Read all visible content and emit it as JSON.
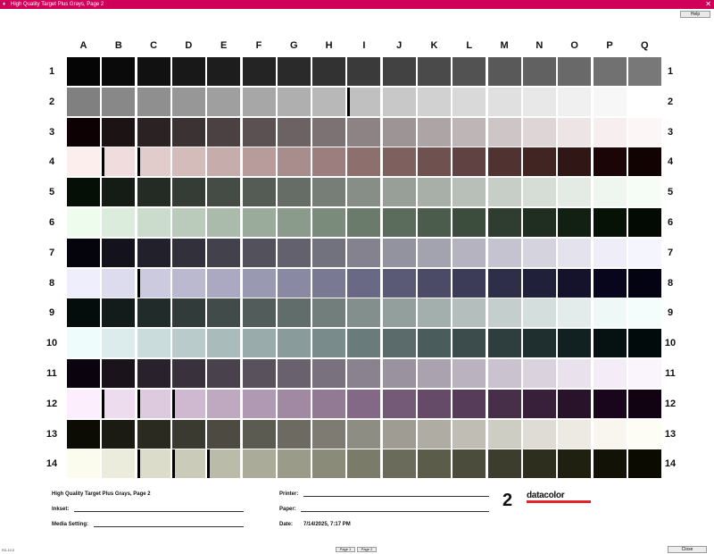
{
  "window": {
    "title": "High Quality Target Plus Grays, Page 2",
    "close_glyph": "✕",
    "help_label": "Help"
  },
  "grid": {
    "columns": [
      "A",
      "B",
      "C",
      "D",
      "E",
      "F",
      "G",
      "H",
      "I",
      "J",
      "K",
      "L",
      "M",
      "N",
      "O",
      "P",
      "Q"
    ],
    "rows": [
      "1",
      "2",
      "3",
      "4",
      "5",
      "6",
      "7",
      "8",
      "9",
      "10",
      "11",
      "12",
      "13",
      "14"
    ],
    "colors": [
      [
        "#050505",
        "#0a0a0a",
        "#111111",
        "#181818",
        "#1d1d1d",
        "#242424",
        "#2a2a2a",
        "#323232",
        "#3a3a3a",
        "#424242",
        "#4a4a4a",
        "#525252",
        "#595959",
        "#616161",
        "#696969",
        "#717171",
        "#787878"
      ],
      [
        "#808080",
        "#888888",
        "#8f8f8f",
        "#979797",
        "#9f9f9f",
        "#a7a7a7",
        "#afafaf",
        "#b8b8b8",
        "#c0c0c0",
        "#c8c8c8",
        "#d1d1d1",
        "#d9d9d9",
        "#e0e0e0",
        "#e8e8e8",
        "#f0f0f0",
        "#f7f7f7",
        "#ffffff"
      ],
      [
        "#0d0103",
        "#1c1314",
        "#2b2223",
        "#3b3233",
        "#4b4142",
        "#5c5152",
        "#6c6263",
        "#7c7273",
        "#8d8384",
        "#9d9495",
        "#ada4a5",
        "#bdb5b6",
        "#cdc5c6",
        "#ddd5d6",
        "#ece4e5",
        "#f7eeef",
        "#fdf6f7"
      ],
      [
        "#fdeeee",
        "#f0dcdc",
        "#e2cccb",
        "#d4bcbb",
        "#c6acab",
        "#b89c9b",
        "#a98d8c",
        "#9b7e7d",
        "#8d6f6e",
        "#7e605f",
        "#6f5250",
        "#5f4241",
        "#503331",
        "#402523",
        "#301716",
        "#1c0506",
        "#120303"
      ],
      [
        "#050f06",
        "#151c16",
        "#232b24",
        "#343c35",
        "#444c45",
        "#545c55",
        "#656d66",
        "#767e77",
        "#868e87",
        "#979f98",
        "#a7afa8",
        "#b7bfb8",
        "#c6cec7",
        "#d6ddd6",
        "#e4ebe4",
        "#eff6ef",
        "#f6fcf6"
      ],
      [
        "#eefcee",
        "#dcecdc",
        "#cbdccc",
        "#bacbbb",
        "#aabbab",
        "#9aab9b",
        "#8a9b8b",
        "#7a8b7b",
        "#6a7b6b",
        "#5b6b5c",
        "#4b5c4c",
        "#3c4c3d",
        "#2e3d2f",
        "#1f2e20",
        "#112012",
        "#061206",
        "#020a03"
      ],
      [
        "#05040d",
        "#14131c",
        "#22212b",
        "#32313b",
        "#42414c",
        "#52515c",
        "#62616d",
        "#72717e",
        "#83828e",
        "#93929f",
        "#a3a2af",
        "#b4b3bf",
        "#c4c3cf",
        "#d4d3de",
        "#e3e2ed",
        "#eeedf8",
        "#f5f5fd"
      ],
      [
        "#eeeefd",
        "#dcdcee",
        "#cbcadf",
        "#bab9d0",
        "#aaa9c1",
        "#9a99b2",
        "#8a89a3",
        "#7a7994",
        "#6a6985",
        "#5b5a76",
        "#4c4b67",
        "#3d3c58",
        "#2f2e49",
        "#21203a",
        "#14132b",
        "#07061c",
        "#030312"
      ],
      [
        "#040d0c",
        "#131c1b",
        "#212b2a",
        "#313b3a",
        "#414c4a",
        "#515c5b",
        "#616d6b",
        "#727e7c",
        "#838f8d",
        "#939f9d",
        "#a3afad",
        "#b4bfbd",
        "#c4cecd",
        "#d4dedc",
        "#e3ecea",
        "#eef8f6",
        "#f5fdfc"
      ],
      [
        "#eefcfc",
        "#dcecec",
        "#cbdcdc",
        "#bacbcb",
        "#aabbbb",
        "#9aabab",
        "#8a9b9b",
        "#7a8b8b",
        "#6a7b7b",
        "#5b6b6b",
        "#4b5c5c",
        "#3c4c4c",
        "#2e3d3d",
        "#1f2e2e",
        "#112020",
        "#061212",
        "#020b0b"
      ],
      [
        "#0b030d",
        "#1b131c",
        "#29212b",
        "#39313b",
        "#49414c",
        "#59515c",
        "#69616d",
        "#79717e",
        "#8a828e",
        "#9a929f",
        "#aaa2af",
        "#bab3bf",
        "#cac3cf",
        "#dad3de",
        "#e9e2ed",
        "#f4edf8",
        "#faf5fd"
      ],
      [
        "#fceefd",
        "#ecdcee",
        "#ddcadf",
        "#ceb9d0",
        "#bfa9c1",
        "#b099b2",
        "#a189a3",
        "#927994",
        "#836985",
        "#745a76",
        "#654b67",
        "#563c58",
        "#472e49",
        "#38203a",
        "#29132b",
        "#1a061c",
        "#110312"
      ],
      [
        "#0d0c04",
        "#1c1b13",
        "#2b2a21",
        "#3b3a31",
        "#4c4a41",
        "#5c5b51",
        "#6d6b61",
        "#7e7c72",
        "#8e8d83",
        "#9f9d93",
        "#afada3",
        "#bfbdb4",
        "#cecdc4",
        "#dedcd4",
        "#eceae3",
        "#f8f6ee",
        "#fdfcf5"
      ],
      [
        "#fcfcee",
        "#ececdc",
        "#dcdccb",
        "#cbcbba",
        "#bbbbaa",
        "#abab9a",
        "#9b9b8a",
        "#8b8b7a",
        "#7b7b6a",
        "#6b6b5b",
        "#5c5c4b",
        "#4c4c3c",
        "#3d3d2e",
        "#2e2e1f",
        "#202011",
        "#121206",
        "#0b0b02"
      ]
    ],
    "bars": [
      [
        false,
        false,
        false,
        false,
        false,
        false,
        false,
        false,
        false,
        false,
        false,
        false,
        false,
        false,
        false,
        false,
        false
      ],
      [
        false,
        false,
        false,
        false,
        false,
        false,
        false,
        false,
        true,
        false,
        false,
        false,
        false,
        false,
        false,
        false,
        false
      ],
      [
        false,
        false,
        false,
        false,
        false,
        false,
        false,
        false,
        false,
        false,
        false,
        false,
        false,
        false,
        false,
        false,
        false
      ],
      [
        false,
        true,
        true,
        false,
        false,
        false,
        false,
        false,
        false,
        false,
        false,
        false,
        false,
        false,
        false,
        false,
        false
      ],
      [
        false,
        false,
        false,
        false,
        false,
        false,
        false,
        false,
        false,
        false,
        false,
        false,
        false,
        false,
        false,
        false,
        false
      ],
      [
        false,
        false,
        false,
        false,
        false,
        false,
        false,
        false,
        false,
        false,
        false,
        false,
        false,
        false,
        false,
        false,
        false
      ],
      [
        false,
        false,
        false,
        false,
        false,
        false,
        false,
        false,
        false,
        false,
        false,
        false,
        false,
        false,
        false,
        false,
        false
      ],
      [
        false,
        false,
        true,
        false,
        false,
        false,
        false,
        false,
        false,
        false,
        false,
        false,
        false,
        false,
        false,
        false,
        false
      ],
      [
        false,
        false,
        false,
        false,
        false,
        false,
        false,
        false,
        false,
        false,
        false,
        false,
        false,
        false,
        false,
        false,
        false
      ],
      [
        false,
        false,
        false,
        false,
        false,
        false,
        false,
        false,
        false,
        false,
        false,
        false,
        false,
        false,
        false,
        false,
        false
      ],
      [
        false,
        false,
        false,
        false,
        false,
        false,
        false,
        false,
        false,
        false,
        false,
        false,
        false,
        false,
        false,
        false,
        false
      ],
      [
        false,
        true,
        true,
        true,
        false,
        false,
        false,
        false,
        false,
        false,
        false,
        false,
        false,
        false,
        false,
        false,
        false
      ],
      [
        false,
        false,
        false,
        false,
        false,
        false,
        false,
        false,
        false,
        false,
        false,
        false,
        false,
        false,
        false,
        false,
        false
      ],
      [
        false,
        false,
        true,
        true,
        true,
        false,
        false,
        false,
        false,
        false,
        false,
        false,
        false,
        false,
        false,
        false,
        false
      ]
    ]
  },
  "footer": {
    "target_title": "High Quality Target Plus Grays, Page 2",
    "inkset_label": "Inkset:",
    "media_label": "Media Setting:",
    "printer_label": "Printer:",
    "paper_label": "Paper:",
    "date_label": "Date:",
    "date_value": "7/14/2025, 7:17 PM",
    "page_number": "2",
    "brand": "datacolor",
    "brand_color": "#e3232c"
  },
  "bottom_bar": {
    "version": "R3-10.0",
    "page1_label": "Page 1",
    "page2_label": "Page 2",
    "close_label": "Close"
  },
  "colors": {
    "titlebar": "#d0005a"
  }
}
